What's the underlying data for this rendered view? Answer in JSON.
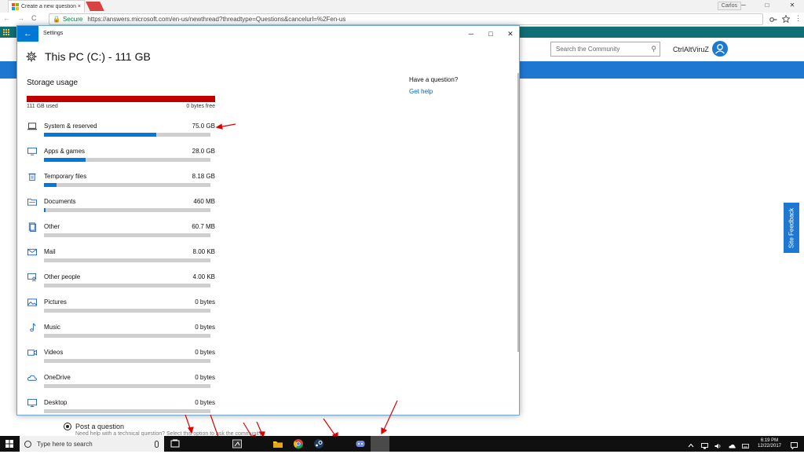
{
  "browser": {
    "tab_title": "Create a new question o",
    "tab_close": "×",
    "windows_user": "Carlos",
    "min_glyph": "─",
    "max_glyph": "□",
    "close_glyph": "✕",
    "nav_back": "←",
    "nav_forward": "→",
    "nav_reload": "C",
    "secure_label": "Secure",
    "url": "https://answers.microsoft.com/en-us/newthread?threadtype=Questions&cancelurl=%2Fen-us"
  },
  "site": {
    "search_placeholder": "Search the Community",
    "username": "CtrlAltViruZ",
    "feedback_label": "Site Feedback",
    "post_question_label": "Post a question",
    "post_question_desc": "Need help with a technical question? Select this option to ask the community."
  },
  "settings": {
    "window_title": "Settings",
    "page_title": "This PC (C:) - 111 GB",
    "section_title": "Storage usage",
    "used_label": "111 GB used",
    "free_label": "0 bytes free",
    "question_heading": "Have a question?",
    "get_help_link": "Get help",
    "categories": [
      {
        "label": "System & reserved",
        "value": "75.0 GB",
        "fraction": 0.675,
        "icon": "laptop-icon"
      },
      {
        "label": "Apps & games",
        "value": "28.0 GB",
        "fraction": 0.25,
        "icon": "monitor-icon"
      },
      {
        "label": "Temporary files",
        "value": "8.18 GB",
        "fraction": 0.074,
        "icon": "trash-icon"
      },
      {
        "label": "Documents",
        "value": "460 MB",
        "fraction": 0.005,
        "icon": "folder-icon"
      },
      {
        "label": "Other",
        "value": "60.7 MB",
        "fraction": 0,
        "icon": "other-files-icon"
      },
      {
        "label": "Mail",
        "value": "8.00 KB",
        "fraction": 0,
        "icon": "mail-icon"
      },
      {
        "label": "Other people",
        "value": "4.00 KB",
        "fraction": 0,
        "icon": "person-icon"
      },
      {
        "label": "Pictures",
        "value": "0 bytes",
        "fraction": 0,
        "icon": "picture-icon"
      },
      {
        "label": "Music",
        "value": "0 bytes",
        "fraction": 0,
        "icon": "music-icon"
      },
      {
        "label": "Videos",
        "value": "0 bytes",
        "fraction": 0,
        "icon": "video-icon"
      },
      {
        "label": "OneDrive",
        "value": "0 bytes",
        "fraction": 0,
        "icon": "cloud-icon"
      },
      {
        "label": "Desktop",
        "value": "0 bytes",
        "fraction": 0,
        "icon": "desktop-icon"
      }
    ]
  },
  "taskbar": {
    "search_placeholder": "Type here to search",
    "time": "6:19 PM",
    "date": "12/22/2017"
  },
  "colors": {
    "accent": "#0078d7",
    "full_bar": "#c00000",
    "site_blue": "#1e78d2",
    "annotation_arrow": "#e00000"
  }
}
